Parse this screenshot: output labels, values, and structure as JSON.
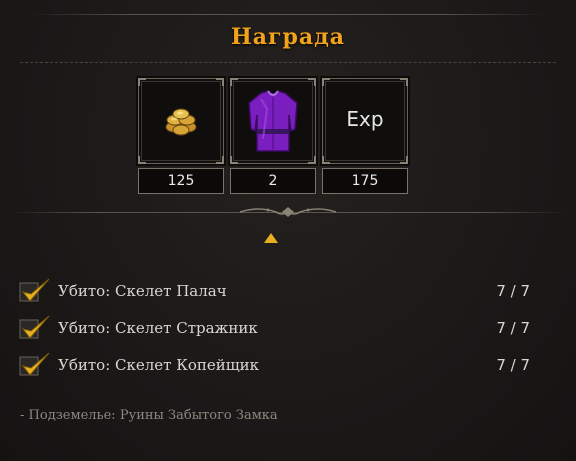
{
  "reward": {
    "title": "Награда",
    "items": [
      {
        "icon": "gold-coins-icon",
        "count": "125"
      },
      {
        "icon": "purple-tunic-icon",
        "count": "2"
      },
      {
        "icon": "exp-icon",
        "label": "Exp",
        "count": "175"
      }
    ]
  },
  "objectives": [
    {
      "label": "Убито: Скелет Палач",
      "progress": "7 / 7",
      "done": true
    },
    {
      "label": "Убито: Скелет Стражник",
      "progress": "7 / 7",
      "done": true
    },
    {
      "label": "Убито: Скелет Копейщик",
      "progress": "7 / 7",
      "done": true
    }
  ],
  "location": "- Подземелье: Руины Забытого Замка",
  "colors": {
    "title": "#f2a21a",
    "check": "#e8b020"
  }
}
